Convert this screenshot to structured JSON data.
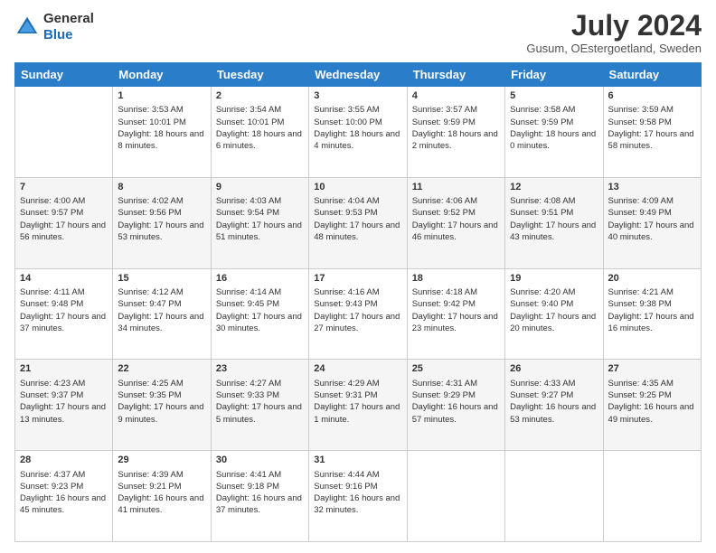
{
  "logo": {
    "line1": "General",
    "line2": "Blue"
  },
  "title": "July 2024",
  "location": "Gusum, OEstergoetland, Sweden",
  "weekdays": [
    "Sunday",
    "Monday",
    "Tuesday",
    "Wednesday",
    "Thursday",
    "Friday",
    "Saturday"
  ],
  "weeks": [
    [
      {
        "day": "",
        "sunrise": "",
        "sunset": "",
        "daylight": ""
      },
      {
        "day": "1",
        "sunrise": "Sunrise: 3:53 AM",
        "sunset": "Sunset: 10:01 PM",
        "daylight": "Daylight: 18 hours and 8 minutes."
      },
      {
        "day": "2",
        "sunrise": "Sunrise: 3:54 AM",
        "sunset": "Sunset: 10:01 PM",
        "daylight": "Daylight: 18 hours and 6 minutes."
      },
      {
        "day": "3",
        "sunrise": "Sunrise: 3:55 AM",
        "sunset": "Sunset: 10:00 PM",
        "daylight": "Daylight: 18 hours and 4 minutes."
      },
      {
        "day": "4",
        "sunrise": "Sunrise: 3:57 AM",
        "sunset": "Sunset: 9:59 PM",
        "daylight": "Daylight: 18 hours and 2 minutes."
      },
      {
        "day": "5",
        "sunrise": "Sunrise: 3:58 AM",
        "sunset": "Sunset: 9:59 PM",
        "daylight": "Daylight: 18 hours and 0 minutes."
      },
      {
        "day": "6",
        "sunrise": "Sunrise: 3:59 AM",
        "sunset": "Sunset: 9:58 PM",
        "daylight": "Daylight: 17 hours and 58 minutes."
      }
    ],
    [
      {
        "day": "7",
        "sunrise": "Sunrise: 4:00 AM",
        "sunset": "Sunset: 9:57 PM",
        "daylight": "Daylight: 17 hours and 56 minutes."
      },
      {
        "day": "8",
        "sunrise": "Sunrise: 4:02 AM",
        "sunset": "Sunset: 9:56 PM",
        "daylight": "Daylight: 17 hours and 53 minutes."
      },
      {
        "day": "9",
        "sunrise": "Sunrise: 4:03 AM",
        "sunset": "Sunset: 9:54 PM",
        "daylight": "Daylight: 17 hours and 51 minutes."
      },
      {
        "day": "10",
        "sunrise": "Sunrise: 4:04 AM",
        "sunset": "Sunset: 9:53 PM",
        "daylight": "Daylight: 17 hours and 48 minutes."
      },
      {
        "day": "11",
        "sunrise": "Sunrise: 4:06 AM",
        "sunset": "Sunset: 9:52 PM",
        "daylight": "Daylight: 17 hours and 46 minutes."
      },
      {
        "day": "12",
        "sunrise": "Sunrise: 4:08 AM",
        "sunset": "Sunset: 9:51 PM",
        "daylight": "Daylight: 17 hours and 43 minutes."
      },
      {
        "day": "13",
        "sunrise": "Sunrise: 4:09 AM",
        "sunset": "Sunset: 9:49 PM",
        "daylight": "Daylight: 17 hours and 40 minutes."
      }
    ],
    [
      {
        "day": "14",
        "sunrise": "Sunrise: 4:11 AM",
        "sunset": "Sunset: 9:48 PM",
        "daylight": "Daylight: 17 hours and 37 minutes."
      },
      {
        "day": "15",
        "sunrise": "Sunrise: 4:12 AM",
        "sunset": "Sunset: 9:47 PM",
        "daylight": "Daylight: 17 hours and 34 minutes."
      },
      {
        "day": "16",
        "sunrise": "Sunrise: 4:14 AM",
        "sunset": "Sunset: 9:45 PM",
        "daylight": "Daylight: 17 hours and 30 minutes."
      },
      {
        "day": "17",
        "sunrise": "Sunrise: 4:16 AM",
        "sunset": "Sunset: 9:43 PM",
        "daylight": "Daylight: 17 hours and 27 minutes."
      },
      {
        "day": "18",
        "sunrise": "Sunrise: 4:18 AM",
        "sunset": "Sunset: 9:42 PM",
        "daylight": "Daylight: 17 hours and 23 minutes."
      },
      {
        "day": "19",
        "sunrise": "Sunrise: 4:20 AM",
        "sunset": "Sunset: 9:40 PM",
        "daylight": "Daylight: 17 hours and 20 minutes."
      },
      {
        "day": "20",
        "sunrise": "Sunrise: 4:21 AM",
        "sunset": "Sunset: 9:38 PM",
        "daylight": "Daylight: 17 hours and 16 minutes."
      }
    ],
    [
      {
        "day": "21",
        "sunrise": "Sunrise: 4:23 AM",
        "sunset": "Sunset: 9:37 PM",
        "daylight": "Daylight: 17 hours and 13 minutes."
      },
      {
        "day": "22",
        "sunrise": "Sunrise: 4:25 AM",
        "sunset": "Sunset: 9:35 PM",
        "daylight": "Daylight: 17 hours and 9 minutes."
      },
      {
        "day": "23",
        "sunrise": "Sunrise: 4:27 AM",
        "sunset": "Sunset: 9:33 PM",
        "daylight": "Daylight: 17 hours and 5 minutes."
      },
      {
        "day": "24",
        "sunrise": "Sunrise: 4:29 AM",
        "sunset": "Sunset: 9:31 PM",
        "daylight": "Daylight: 17 hours and 1 minute."
      },
      {
        "day": "25",
        "sunrise": "Sunrise: 4:31 AM",
        "sunset": "Sunset: 9:29 PM",
        "daylight": "Daylight: 16 hours and 57 minutes."
      },
      {
        "day": "26",
        "sunrise": "Sunrise: 4:33 AM",
        "sunset": "Sunset: 9:27 PM",
        "daylight": "Daylight: 16 hours and 53 minutes."
      },
      {
        "day": "27",
        "sunrise": "Sunrise: 4:35 AM",
        "sunset": "Sunset: 9:25 PM",
        "daylight": "Daylight: 16 hours and 49 minutes."
      }
    ],
    [
      {
        "day": "28",
        "sunrise": "Sunrise: 4:37 AM",
        "sunset": "Sunset: 9:23 PM",
        "daylight": "Daylight: 16 hours and 45 minutes."
      },
      {
        "day": "29",
        "sunrise": "Sunrise: 4:39 AM",
        "sunset": "Sunset: 9:21 PM",
        "daylight": "Daylight: 16 hours and 41 minutes."
      },
      {
        "day": "30",
        "sunrise": "Sunrise: 4:41 AM",
        "sunset": "Sunset: 9:18 PM",
        "daylight": "Daylight: 16 hours and 37 minutes."
      },
      {
        "day": "31",
        "sunrise": "Sunrise: 4:44 AM",
        "sunset": "Sunset: 9:16 PM",
        "daylight": "Daylight: 16 hours and 32 minutes."
      },
      {
        "day": "",
        "sunrise": "",
        "sunset": "",
        "daylight": ""
      },
      {
        "day": "",
        "sunrise": "",
        "sunset": "",
        "daylight": ""
      },
      {
        "day": "",
        "sunrise": "",
        "sunset": "",
        "daylight": ""
      }
    ]
  ]
}
